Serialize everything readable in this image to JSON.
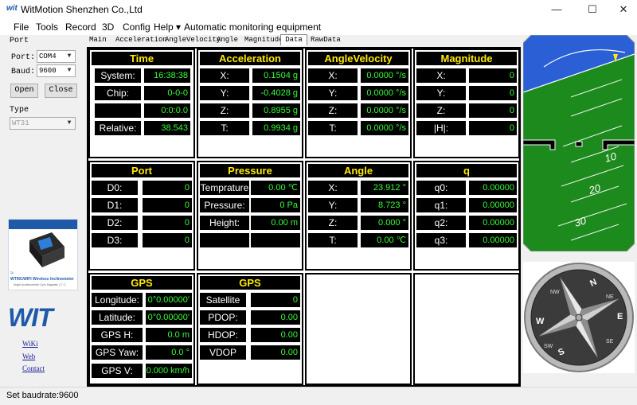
{
  "window": {
    "title": "WitMotion Shenzhen Co.,Ltd",
    "logo_text": "wit",
    "minimize": "—",
    "maximize": "☐",
    "close": "✕"
  },
  "menu": [
    {
      "label": "File"
    },
    {
      "label": "Tools"
    },
    {
      "label": "Record"
    },
    {
      "label": "3D"
    },
    {
      "label": "Config"
    },
    {
      "label": "Help ▾"
    },
    {
      "label": "Automatic monitoring equipment"
    }
  ],
  "left": {
    "port_group": "Port",
    "port_label": "Port:",
    "port_value": "COM4",
    "baud_label": "Baud:",
    "baud_value": "9600",
    "open_button": "Open",
    "close_button": "Close",
    "type_group": "Type",
    "type_value": "WT31",
    "product_caption": "WT901WIFI  Wireless Inclinometer",
    "product_sub": "Angle Accelerometer Gyro Magnetic 2.7-C",
    "brand": "WIT",
    "links": [
      "WiKi",
      "Web",
      "Contact"
    ]
  },
  "tabs": [
    "Main",
    "Acceleration",
    "AngleVelocity",
    "Angle",
    "Magnitude",
    "Data",
    "RawData"
  ],
  "active_tab": "Data",
  "panels": {
    "time": {
      "title": "Time",
      "rows": [
        {
          "label": "System:",
          "value": "16:38:38"
        },
        {
          "label": "Chip:",
          "value": "0-0-0"
        },
        {
          "label": "",
          "value": "0:0:0.0"
        },
        {
          "label": "Relative:",
          "value": "38.543"
        }
      ]
    },
    "acceleration": {
      "title": "Acceleration",
      "rows": [
        {
          "label": "X:",
          "value": "0.1504 g"
        },
        {
          "label": "Y:",
          "value": "-0.4028 g"
        },
        {
          "label": "Z:",
          "value": "0.8955 g"
        },
        {
          "label": "T:",
          "value": "0.9934 g"
        }
      ]
    },
    "anglevelocity": {
      "title": "AngleVelocity",
      "rows": [
        {
          "label": "X:",
          "value": "0.0000 °/s"
        },
        {
          "label": "Y:",
          "value": "0.0000 °/s"
        },
        {
          "label": "Z:",
          "value": "0.0000 °/s"
        },
        {
          "label": "T:",
          "value": "0.0000 °/s"
        }
      ]
    },
    "magnitude": {
      "title": "Magnitude",
      "rows": [
        {
          "label": "X:",
          "value": "0"
        },
        {
          "label": "Y:",
          "value": "0"
        },
        {
          "label": "Z:",
          "value": "0"
        },
        {
          "label": "|H|:",
          "value": "0"
        }
      ]
    },
    "port": {
      "title": "Port",
      "rows": [
        {
          "label": "D0:",
          "value": "0"
        },
        {
          "label": "D1:",
          "value": "0"
        },
        {
          "label": "D2:",
          "value": "0"
        },
        {
          "label": "D3:",
          "value": "0"
        }
      ]
    },
    "pressure": {
      "title": "Pressure",
      "rows": [
        {
          "label": "Temprature",
          "value": "0.00 ℃"
        },
        {
          "label": "Pressure:",
          "value": "0 Pa"
        },
        {
          "label": "Height:",
          "value": "0.00 m"
        },
        {
          "label": "",
          "value": ""
        }
      ]
    },
    "angle": {
      "title": "Angle",
      "rows": [
        {
          "label": "X:",
          "value": "23.912 °"
        },
        {
          "label": "Y:",
          "value": "8.723 °"
        },
        {
          "label": "Z:",
          "value": "0.000 °"
        },
        {
          "label": "T:",
          "value": "0.00 ℃"
        }
      ]
    },
    "q": {
      "title": "q",
      "rows": [
        {
          "label": "q0:",
          "value": "0.00000"
        },
        {
          "label": "q1:",
          "value": "0.00000"
        },
        {
          "label": "q2:",
          "value": "0.00000"
        },
        {
          "label": "q3:",
          "value": "0.00000"
        }
      ]
    },
    "gps1": {
      "title": "GPS",
      "rows": [
        {
          "label": "Longitude:",
          "value": "0°0.00000'"
        },
        {
          "label": "Latitude:",
          "value": "0°0.00000'"
        },
        {
          "label": "GPS H:",
          "value": "0.0 m"
        },
        {
          "label": "GPS Yaw:",
          "value": "0.0 °"
        },
        {
          "label": "GPS V:",
          "value": "0.000 km/h"
        }
      ]
    },
    "gps2": {
      "title": "GPS",
      "rows": [
        {
          "label": "Satellite",
          "value": "0"
        },
        {
          "label": "PDOP:",
          "value": "0.00"
        },
        {
          "label": "HDOP:",
          "value": "0.00"
        },
        {
          "label": "VDOP",
          "value": "0.00"
        }
      ]
    }
  },
  "horizon": {
    "pitch_labels": [
      "10",
      "20",
      "30"
    ]
  },
  "compass": {
    "letters": [
      "N",
      "E",
      "S",
      "W",
      "NE",
      "SE",
      "SW",
      "NW"
    ]
  },
  "status": {
    "text": "Set baudrate:9600"
  },
  "colors": {
    "title_yellow": "#ffea00",
    "value_green": "#34ff34",
    "sky": "#2a5fd6",
    "ground": "#1d8a1d"
  }
}
